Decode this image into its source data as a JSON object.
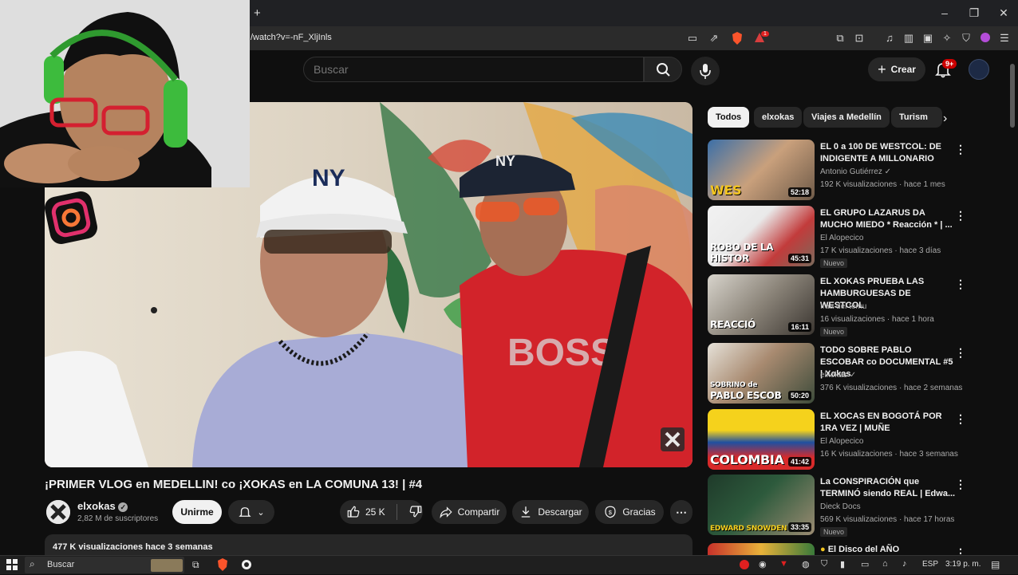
{
  "browser": {
    "new_tab_label": "+",
    "url": "/watch?v=-nF_XljInls",
    "ext_badge": "1"
  },
  "youtube": {
    "search_placeholder": "Buscar",
    "create_label": "Crear",
    "notif_count": "9+"
  },
  "video": {
    "title": "¡PRIMER VLOG en MEDELLIN! co ¡XOKAS en LA COMUNA 13! | #4",
    "channel": "elxokas",
    "subscribers": "2,82 M de suscriptores",
    "join_label": "Unirme",
    "likes": "25 K",
    "share_label": "Compartir",
    "download_label": "Descargar",
    "thanks_label": "Gracias",
    "description": "477 K visualizaciones  hace 3 semanas",
    "shirt_text": "BOSS"
  },
  "chips": [
    "Todos",
    "elxokas",
    "Viajes a Medellín",
    "Turism"
  ],
  "recommendations": [
    {
      "title": "EL 0 a 100 DE WESTCOL: DE INDIGENTE A MILLONARIO",
      "channel": "Antonio Gutiérrez",
      "verified": true,
      "meta": "192 K visualizaciones · hace 1 mes",
      "duration": "52:18",
      "caption": "WES",
      "is_new": false
    },
    {
      "title": "EL GRUPO LAZARUS DA MUCHO MIEDO * Reacción * | ...",
      "channel": "El Alopecico",
      "verified": false,
      "meta": "17 K visualizaciones · hace 3 días",
      "duration": "45:31",
      "caption": "ROBO DE LA HISTOR",
      "is_new": true
    },
    {
      "title": "EL XOKAS PRUEBA LAS HAMBURGUESAS DE WESTCOL",
      "channel": "Iraa del temu",
      "verified": false,
      "meta": "16 visualizaciones · hace 1 hora",
      "duration": "16:11",
      "caption": "REACCIÓ",
      "is_new": true
    },
    {
      "title": "TODO SOBRE PABLO ESCOBAR co DOCUMENTAL #5 | Xokas",
      "channel": "elxokas",
      "verified": true,
      "meta": "376 K visualizaciones · hace 2 semanas",
      "duration": "50:20",
      "caption": "PABLO ESCOB",
      "caption2": "SOBRINO de",
      "is_new": false
    },
    {
      "title": "EL XOCAS EN BOGOTÁ POR 1RA VEZ | MUÑE",
      "channel": "El Alopecico",
      "verified": false,
      "meta": "16 K visualizaciones · hace 3 semanas",
      "duration": "41:42",
      "caption": "COLOMBIA",
      "is_new": false
    },
    {
      "title": "La CONSPIRACIÓN que TERMINÓ siendo REAL | Edwa...",
      "channel": "Dieck Docs",
      "verified": false,
      "meta": "569 K visualizaciones · hace 17 horas",
      "duration": "33:35",
      "caption": "EDWARD SNOWDEN",
      "is_new": true
    },
    {
      "title": "El Disco del AÑO",
      "channel": "",
      "verified": false,
      "meta": "",
      "duration": "",
      "caption": "",
      "is_new": false
    }
  ],
  "new_label": "Nuevo",
  "taskbar": {
    "search_placeholder": "Buscar",
    "lang": "ESP",
    "time": "3:19 p. m."
  }
}
